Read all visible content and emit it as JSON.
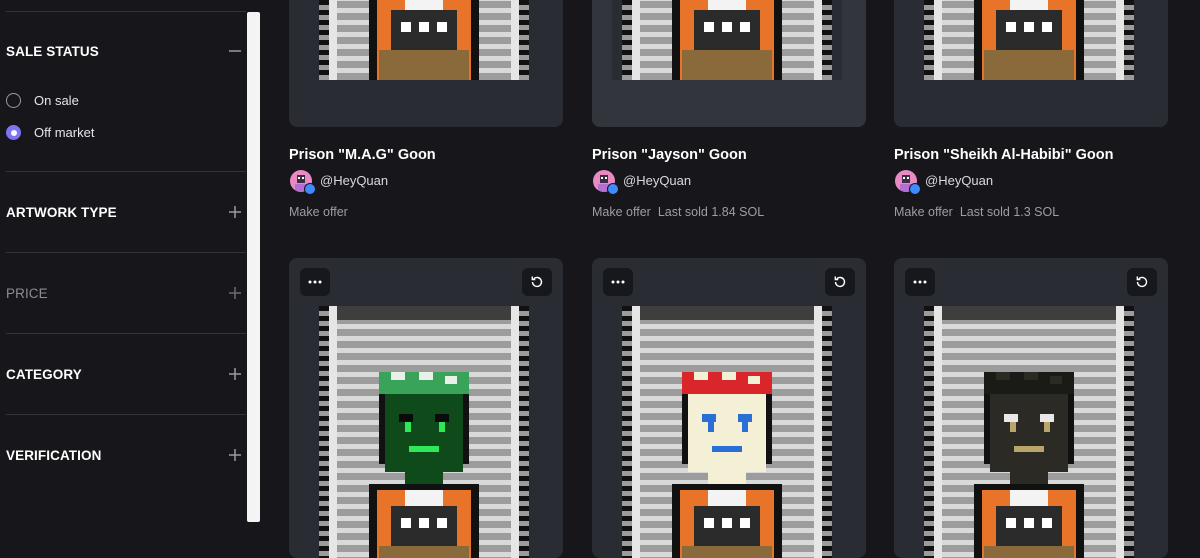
{
  "sidebar": {
    "sections": [
      {
        "title": "SALE STATUS",
        "toggle": "minus-icon",
        "expanded": true,
        "options": [
          {
            "label": "On sale",
            "selected": false
          },
          {
            "label": "Off market",
            "selected": true
          }
        ]
      },
      {
        "title": "ARTWORK TYPE",
        "toggle": "plus-icon",
        "expanded": false
      },
      {
        "title": "PRICE",
        "toggle": "plus-icon",
        "expanded": false,
        "dimmed": true
      },
      {
        "title": "CATEGORY",
        "toggle": "plus-icon",
        "expanded": false
      },
      {
        "title": "VERIFICATION",
        "toggle": "plus-icon",
        "expanded": false
      }
    ]
  },
  "colors": {
    "background": "#16161b",
    "card": "#2a2c33",
    "accent": "#7d74f5",
    "verified": "#3d8bff"
  },
  "nfts_row1": [
    {
      "title": "Prison \"M.A.G\" Goon",
      "creator": "@HeyQuan",
      "offer": "Make offer",
      "last_sold": ""
    },
    {
      "title": "Prison \"Jayson\" Goon",
      "creator": "@HeyQuan",
      "offer": "Make offer",
      "last_sold": "Last sold 1.84 SOL"
    },
    {
      "title": "Prison \"Sheikh Al-Habibi\" Goon",
      "creator": "@HeyQuan",
      "offer": "Make offer",
      "last_sold": "Last sold 1.3 SOL"
    }
  ],
  "nfts_row2": [
    {
      "art": "green-masked-goon"
    },
    {
      "art": "clown-bandana-goon"
    },
    {
      "art": "black-masked-goon"
    }
  ],
  "icons": {
    "more": "more-dots-icon",
    "refresh": "refresh-icon"
  }
}
